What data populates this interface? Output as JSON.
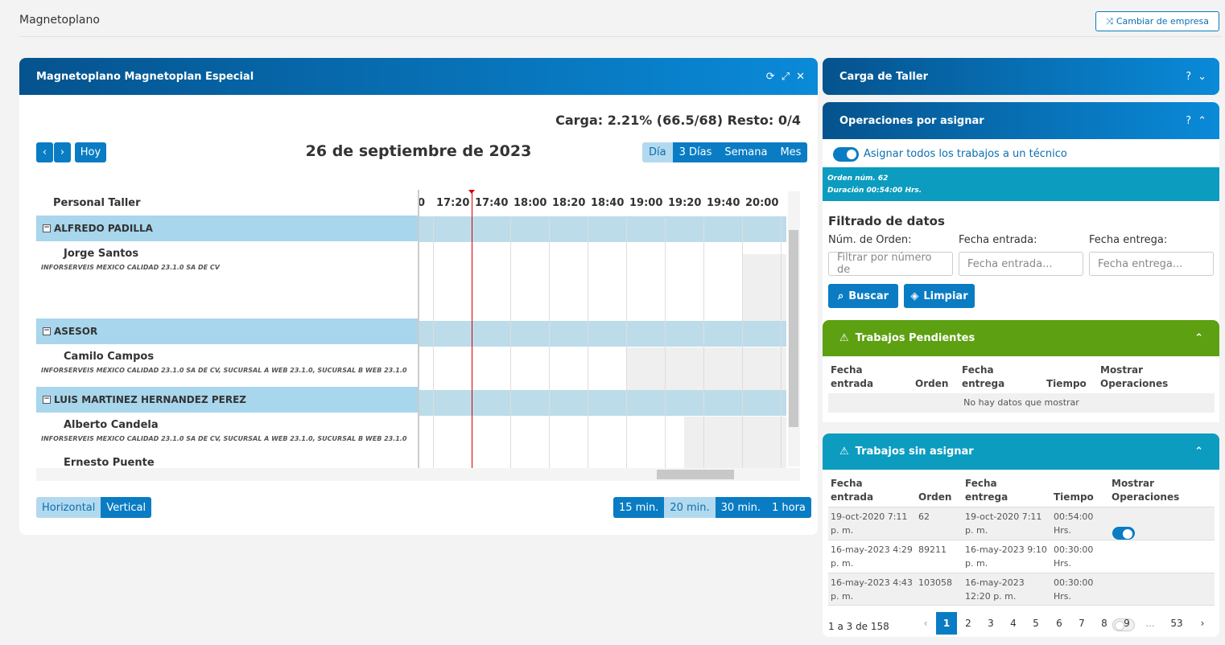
{
  "header": {
    "title": "Magnetoplano",
    "switch_company": "Cambiar de empresa"
  },
  "board": {
    "title": "Magnetoplano Magnetoplan Especial",
    "load": "Carga: 2.21% (66.5/68) Resto: 0/4",
    "today": "Hoy",
    "date": "26 de septiembre de 2023",
    "views": [
      "Día",
      "3 Días",
      "Semana",
      "Mes"
    ],
    "column_header": "Personal Taller",
    "times": [
      "17:20",
      "17:40",
      "18:00",
      "18:20",
      "18:40",
      "19:00",
      "19:20",
      "19:40",
      "20:00"
    ],
    "groups": [
      {
        "name": "ALFREDO PADILLA",
        "person": "Jorge Santos",
        "company": "INFORSERVEIS MEXICO CALIDAD 23.1.0 SA DE CV"
      },
      {
        "name": "ASESOR",
        "person": "Camilo Campos",
        "company": "INFORSERVEIS MEXICO CALIDAD 23.1.0 SA DE CV, SUCURSAL A WEB 23.1.0, SUCURSAL B WEB 23.1.0"
      },
      {
        "name": "LUIS MARTINEZ HERNANDEZ PEREZ",
        "person": "Alberto Candela",
        "company": "INFORSERVEIS MEXICO CALIDAD 23.1.0 SA DE CV, SUCURSAL A WEB 23.1.0, SUCURSAL B WEB 23.1.0"
      }
    ],
    "next_person": "Ernesto Puente",
    "orientation": [
      "Horizontal",
      "Vertical"
    ],
    "intervals": [
      "15 min.",
      "20 min.",
      "30 min.",
      "1 hora"
    ]
  },
  "carga": {
    "title": "Carga de Taller",
    "help": "?"
  },
  "ops": {
    "title": "Operaciones por asignar",
    "help": "?",
    "assign_all": "Asignar todos los trabajos a un técnico",
    "order_info": "Orden núm. 62",
    "duration_info": "Duración 00:54:00 Hrs.",
    "filter_title": "Filtrado de datos",
    "label_order": "Núm. de Orden:",
    "label_in": "Fecha entrada:",
    "label_out": "Fecha entrega:",
    "ph_order": "Filtrar por número de",
    "ph_in": "Fecha entrada...",
    "ph_out": "Fecha entrega...",
    "search": "Buscar",
    "clear": "Limpiar"
  },
  "pending": {
    "title": "Trabajos Pendientes",
    "cols": [
      "Fecha entrada",
      "Orden",
      "Fecha entrega",
      "Tiempo",
      "Mostrar Operaciones"
    ],
    "empty": "No hay datos que mostrar"
  },
  "unassigned": {
    "title": "Trabajos sin asignar",
    "cols": [
      "Fecha entrada",
      "Orden",
      "Fecha entrega",
      "Tiempo",
      "Mostrar Operaciones"
    ],
    "rows": [
      {
        "in": "19-oct-2020 7:11 p. m.",
        "order": "62",
        "out": "19-oct-2020 7:11 p. m.",
        "time": "00:54:00 Hrs.",
        "show": true
      },
      {
        "in": "16-may-2023 4:29 p. m.",
        "order": "89211",
        "out": "16-may-2023 9:10 p. m.",
        "time": "00:30:00 Hrs.",
        "show": false
      },
      {
        "in": "16-may-2023 4:43 p. m.",
        "order": "103058",
        "out": "16-may-2023 12:20 p. m.",
        "time": "00:30:00 Hrs.",
        "show": false
      }
    ],
    "summary": "1 a 3 de 158",
    "pages": [
      "1",
      "2",
      "3",
      "4",
      "5",
      "6",
      "7",
      "8",
      "9",
      "...",
      "53"
    ],
    "current_page": "1"
  },
  "colors": {
    "primary": "#0a7cc4",
    "green": "#5da012",
    "teal": "#0b9cc0",
    "band": "#a8d6ec"
  }
}
